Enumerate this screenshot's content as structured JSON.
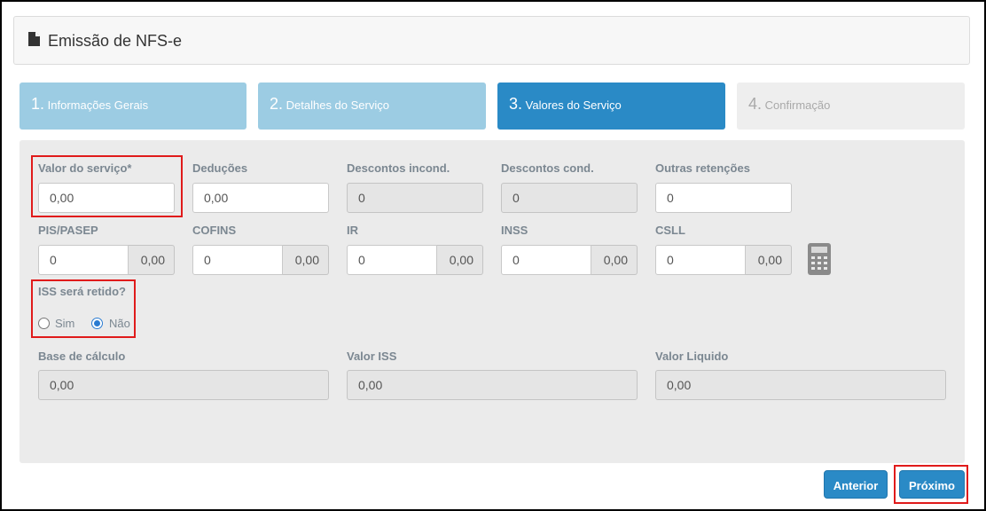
{
  "header": {
    "title": "Emissão de NFS-e",
    "icon": "document-icon"
  },
  "steps": [
    {
      "num": "1.",
      "label": "Informações Gerais",
      "state": "done"
    },
    {
      "num": "2.",
      "label": "Detalhes do Serviço",
      "state": "done"
    },
    {
      "num": "3.",
      "label": "Valores do Serviço",
      "state": "active"
    },
    {
      "num": "4.",
      "label": "Confirmação",
      "state": "pending"
    }
  ],
  "row1": [
    {
      "label": "Valor do serviço*",
      "value": "0,00",
      "readonly": false
    },
    {
      "label": "Deduções",
      "value": "0,00",
      "readonly": false
    },
    {
      "label": "Descontos incond.",
      "value": "0",
      "readonly": true
    },
    {
      "label": "Descontos cond.",
      "value": "0",
      "readonly": true
    },
    {
      "label": "Outras retenções",
      "value": "0",
      "readonly": false
    }
  ],
  "row2": [
    {
      "label": "PIS/PASEP",
      "value": "0",
      "amount": "0,00"
    },
    {
      "label": "COFINS",
      "value": "0",
      "amount": "0,00"
    },
    {
      "label": "IR",
      "value": "0",
      "amount": "0,00"
    },
    {
      "label": "INSS",
      "value": "0",
      "amount": "0,00"
    },
    {
      "label": "CSLL",
      "value": "0",
      "amount": "0,00"
    }
  ],
  "iss": {
    "label": "ISS será retido?",
    "options": [
      "Sim",
      "Não"
    ],
    "selected": "Não"
  },
  "totals": [
    {
      "label": "Base de cálculo",
      "value": "0,00"
    },
    {
      "label": "Valor ISS",
      "value": "0,00"
    },
    {
      "label": "Valor Liquido",
      "value": "0,00"
    }
  ],
  "buttons": {
    "previous": "Anterior",
    "next": "Próximo"
  },
  "colors": {
    "accent": "#2a8ac6",
    "step_done": "#9ccce3",
    "highlight": "#e01b1b"
  }
}
